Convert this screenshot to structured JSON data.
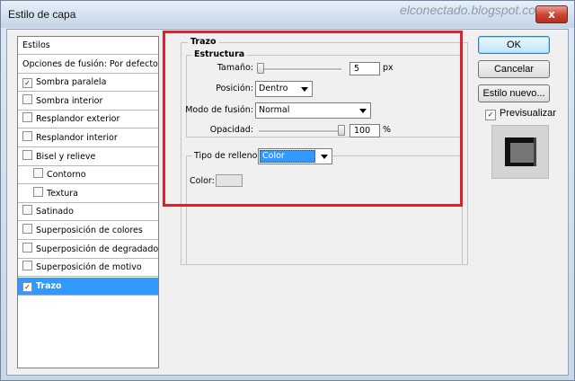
{
  "window": {
    "title": "Estilo de capa",
    "watermark": "elconectado.blogspot.com",
    "close_glyph": "x"
  },
  "styles_list": {
    "items": [
      {
        "label": "Estilos",
        "checkbox": false,
        "checked": false,
        "indent": false,
        "selected": false
      },
      {
        "label": "Opciones de fusión: Por defecto",
        "checkbox": false,
        "checked": false,
        "indent": false,
        "selected": false
      },
      {
        "label": "Sombra paralela",
        "checkbox": true,
        "checked": true,
        "indent": false,
        "selected": false
      },
      {
        "label": "Sombra interior",
        "checkbox": true,
        "checked": false,
        "indent": false,
        "selected": false
      },
      {
        "label": "Resplandor exterior",
        "checkbox": true,
        "checked": false,
        "indent": false,
        "selected": false
      },
      {
        "label": "Resplandor interior",
        "checkbox": true,
        "checked": false,
        "indent": false,
        "selected": false
      },
      {
        "label": "Bisel y relieve",
        "checkbox": true,
        "checked": false,
        "indent": false,
        "selected": false
      },
      {
        "label": "Contorno",
        "checkbox": true,
        "checked": false,
        "indent": true,
        "selected": false
      },
      {
        "label": "Textura",
        "checkbox": true,
        "checked": false,
        "indent": true,
        "selected": false
      },
      {
        "label": "Satinado",
        "checkbox": true,
        "checked": false,
        "indent": false,
        "selected": false
      },
      {
        "label": "Superposición de colores",
        "checkbox": true,
        "checked": false,
        "indent": false,
        "selected": false
      },
      {
        "label": "Superposición de degradado",
        "checkbox": true,
        "checked": false,
        "indent": false,
        "selected": false
      },
      {
        "label": "Superposición de motivo",
        "checkbox": true,
        "checked": false,
        "indent": false,
        "selected": false
      },
      {
        "label": "Trazo",
        "checkbox": true,
        "checked": true,
        "indent": false,
        "selected": true
      }
    ]
  },
  "buttons": {
    "ok": "OK",
    "cancel": "Cancelar",
    "new_style": "Estilo nuevo..."
  },
  "preview": {
    "label": "Previsualizar",
    "checked": true
  },
  "stroke": {
    "group_title": "Trazo",
    "structure_title": "Estructura",
    "size": {
      "label": "Tamaño:",
      "value": "5",
      "unit": "px",
      "slider_fraction": 0.02
    },
    "position": {
      "label": "Posición:",
      "value": "Dentro"
    },
    "blend_mode": {
      "label": "Modo de fusión:",
      "value": "Normal"
    },
    "opacity": {
      "label": "Opacidad:",
      "value": "100",
      "unit": "%",
      "slider_fraction": 1.0
    },
    "fill_type": {
      "label": "Tipo de relleno:",
      "value": "Color"
    },
    "color": {
      "label": "Color:",
      "swatch": "#e4e4e4"
    }
  },
  "colors": {
    "selection": "#3399ff",
    "highlight_box": "#d9232c",
    "close_button": "#c8432f"
  }
}
